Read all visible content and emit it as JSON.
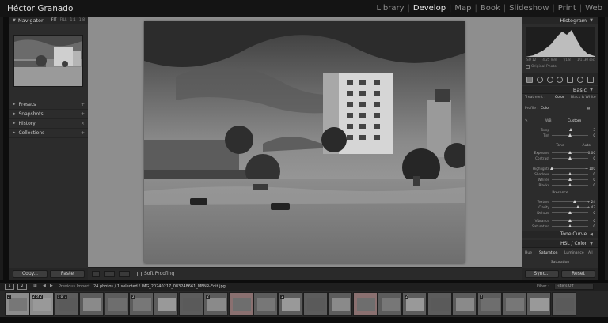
{
  "identity": "Héctor Granado",
  "modules": [
    "Library",
    "Develop",
    "Map",
    "Book",
    "Slideshow",
    "Print",
    "Web"
  ],
  "active_module": "Develop",
  "left_panel": {
    "navigator": {
      "title": "Navigator",
      "tabs": [
        "FIT",
        "FILL",
        "1:1",
        "1:8"
      ]
    },
    "sections": [
      {
        "label": "Presets",
        "action": "+"
      },
      {
        "label": "Snapshots",
        "action": "+"
      },
      {
        "label": "History",
        "action": "×"
      },
      {
        "label": "Collections",
        "action": "+"
      }
    ],
    "copy_label": "Copy...",
    "paste_label": "Paste"
  },
  "toolbar": {
    "soft_proofing": "Soft Proofing"
  },
  "right_panel": {
    "histogram_title": "Histogram",
    "readout": [
      "ISO 12",
      "4.25 mm",
      "f/1.8",
      "1/1130 sec"
    ],
    "original_photo": "Original Photo",
    "basic_title": "Basic",
    "treatment_label": "Treatment :",
    "treatment_color": "Color",
    "treatment_bw": "Black & White",
    "profile_label": "Profile :",
    "profile_value": "Color",
    "wb_label": "WB :",
    "wb_value": "Custom",
    "tone_label": "Tone",
    "tone_auto": "Auto",
    "presence_label": "Presence",
    "sliders": [
      {
        "label": "Temp",
        "value": "+ 3",
        "pos": 0.52
      },
      {
        "label": "Tint",
        "value": "0",
        "pos": 0.5
      },
      {
        "label": "Exposure",
        "value": "0.00",
        "pos": 0.5
      },
      {
        "label": "Contrast",
        "value": "0",
        "pos": 0.5
      },
      {
        "label": "Highlights",
        "value": "− 100",
        "pos": 0.0
      },
      {
        "label": "Shadows",
        "value": "0",
        "pos": 0.5
      },
      {
        "label": "Whites",
        "value": "0",
        "pos": 0.5
      },
      {
        "label": "Blacks",
        "value": "0",
        "pos": 0.5
      },
      {
        "label": "Texture",
        "value": "+ 24",
        "pos": 0.62
      },
      {
        "label": "Clarity",
        "value": "+ 43",
        "pos": 0.72
      },
      {
        "label": "Dehaze",
        "value": "0",
        "pos": 0.5
      },
      {
        "label": "Vibrance",
        "value": "0",
        "pos": 0.5
      },
      {
        "label": "Saturation",
        "value": "0",
        "pos": 0.5
      }
    ],
    "tone_curve": "Tone Curve",
    "hsl_title": "HSL / Color",
    "hsl_tabs": [
      "Hue",
      "Saturation",
      "Luminance",
      "All"
    ],
    "hsl_sub": "Saturation",
    "sync_label": "Sync...",
    "reset_label": "Reset"
  },
  "filmstrip": {
    "monitor_1": "1",
    "monitor_2": "2",
    "previous_import": "Previous Import",
    "info": "24 photos / 1 selected / IMG_20240217_083248661_MFNR-Edit.jpg",
    "filter_label": "Filter :",
    "filter_value": "Filters Off",
    "badges": [
      "2",
      "2 of 2",
      "1 of 3",
      "",
      "",
      "2",
      "",
      "",
      "2",
      "",
      "",
      "2",
      "",
      "",
      "",
      "",
      "2",
      "",
      "",
      "2",
      "",
      "",
      ""
    ]
  }
}
